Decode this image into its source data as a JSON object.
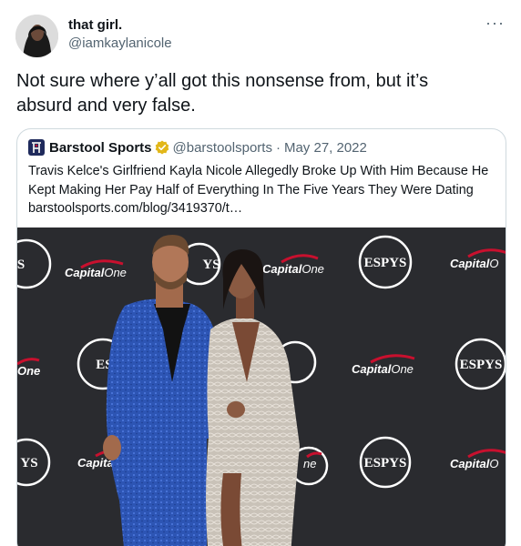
{
  "tweet": {
    "author_name": "that girl.",
    "author_handle": "@iamkaylanicole",
    "more_icon": "more-icon",
    "text_line1": "Not sure where y’all got this nonsense from, but it’s",
    "text_line2": "absurd and very false."
  },
  "quote": {
    "author_name": "Barstool Sports",
    "verified_icon": "verified-badge-icon",
    "author_handle": "@barstoolsports",
    "separator": "·",
    "date": "May 27, 2022",
    "text_line1": "Travis Kelce's Girlfriend Kayla Nicole Allegedly Broke Up With Him Because He",
    "text_line2": "Kept Making Her Pay Half of Everything In The Five Years They Were Dating",
    "link": "barstoolsports.com/blog/3419370/t…"
  },
  "backdrop": {
    "sponsor_logo": "Capital One",
    "event_logo": "ESPYS"
  },
  "colors": {
    "handle_gray": "#536471",
    "verified_gold": "#e2b719",
    "backdrop": "#2a2b2f",
    "capital_one_red": "#c8102e"
  }
}
